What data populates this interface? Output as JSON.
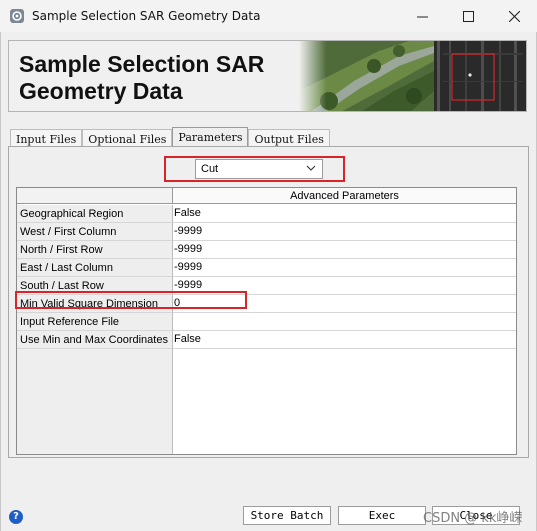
{
  "window": {
    "title": "Sample Selection SAR Geometry Data",
    "minimize_glyph": "—",
    "maximize_glyph": "☐",
    "close_glyph": "✕"
  },
  "banner": {
    "line1": "Sample Selection SAR",
    "line2": "Geometry Data"
  },
  "tabs": [
    {
      "label": "Input Files",
      "active": false
    },
    {
      "label": "Optional Files",
      "active": false
    },
    {
      "label": "Parameters",
      "active": true
    },
    {
      "label": "Output Files",
      "active": false
    }
  ],
  "mode_select": {
    "value": "Cut"
  },
  "table": {
    "header": "Advanced Parameters",
    "rows": [
      {
        "label": "Geographical Region",
        "value": "False"
      },
      {
        "label": "West / First Column",
        "value": "-9999"
      },
      {
        "label": "North / First Row",
        "value": "-9999"
      },
      {
        "label": "East / Last Column",
        "value": "-9999"
      },
      {
        "label": "South / Last Row",
        "value": "-9999"
      },
      {
        "label": "Min Valid Square Dimension",
        "value": "0"
      },
      {
        "label": "Input Reference File",
        "value": ""
      },
      {
        "label": "Use Min and Max Coordinates",
        "value": "False"
      }
    ]
  },
  "buttons": {
    "help": "?",
    "store_batch": "Store Batch",
    "exec": "Exec",
    "close": "Close"
  },
  "watermark": "CSDN @ kk峥嵘",
  "colors": {
    "highlight": "#d9252a",
    "help_icon": "#1f5fc4"
  }
}
